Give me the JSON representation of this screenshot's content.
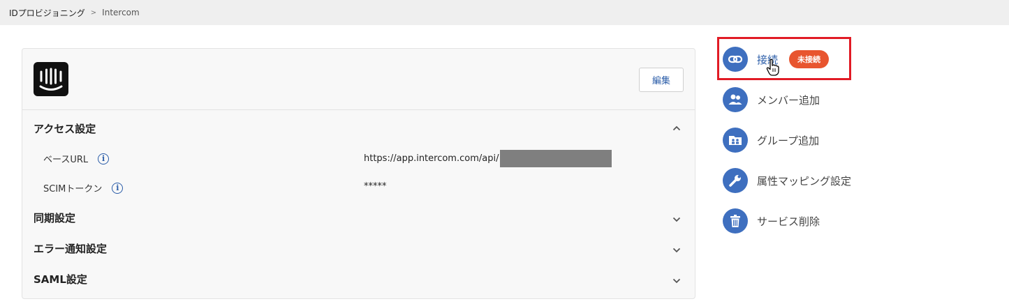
{
  "breadcrumb": {
    "root": "IDプロビジョニング",
    "separator": ">",
    "current": "Intercom"
  },
  "card": {
    "edit_label": "編集",
    "sections": {
      "access": "アクセス設定",
      "sync": "同期設定",
      "error_notify": "エラー通知設定",
      "saml": "SAML設定"
    },
    "rows": {
      "base_url_label": "ベースURL",
      "base_url_value": "https://app.intercom.com/api/",
      "scim_label": "SCIMトークン",
      "scim_value": "*****"
    },
    "info_glyph": "i"
  },
  "sidebar": {
    "connect": {
      "label": "接続",
      "badge": "未接続"
    },
    "add_member": "メンバー追加",
    "add_group": "グループ追加",
    "attr_mapping": "属性マッピング設定",
    "delete_service": "サービス削除"
  },
  "colors": {
    "accent": "#3e6fbf",
    "link": "#2a5ca8",
    "badge": "#e8552f",
    "highlight": "#e11b25"
  }
}
